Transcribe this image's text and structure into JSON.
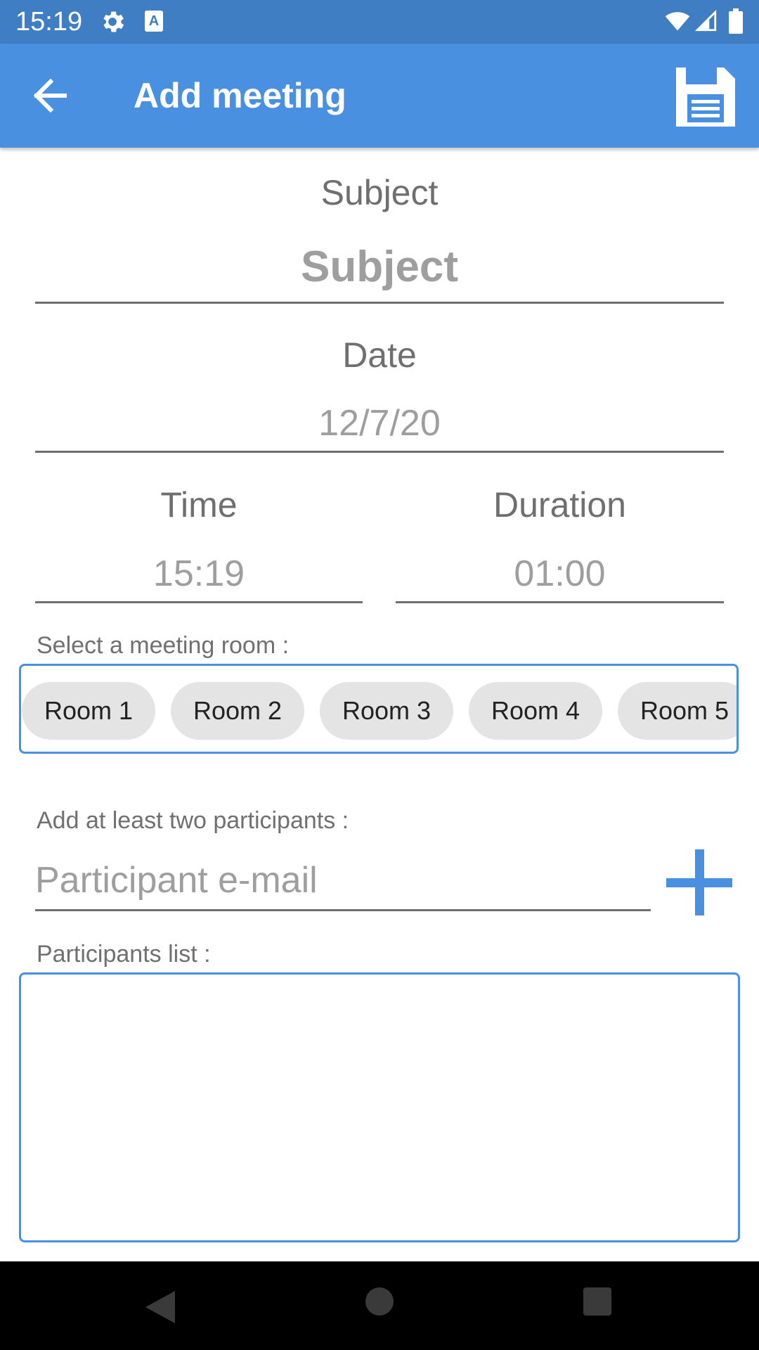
{
  "status_bar": {
    "time": "15:19",
    "icons": [
      "gear-icon",
      "a-keyboard-icon",
      "wifi-icon",
      "signal-icon",
      "battery-icon"
    ],
    "a_icon_text": "A"
  },
  "app_bar": {
    "title": "Add meeting",
    "back_icon": "arrow-left-icon",
    "save_icon": "floppy-disk-icon",
    "color": "#4a90e0"
  },
  "form": {
    "subject": {
      "label": "Subject",
      "placeholder": "Subject"
    },
    "date": {
      "label": "Date",
      "value": "12/7/20"
    },
    "time": {
      "label": "Time",
      "value": "15:19"
    },
    "duration": {
      "label": "Duration",
      "value": "01:00"
    },
    "room": {
      "label": "Select a meeting room :",
      "options": [
        "Room 1",
        "Room 2",
        "Room 3",
        "Room 4",
        "Room 5"
      ]
    },
    "participants": {
      "label": "Add at least two participants :",
      "email_placeholder": "Participant e-mail",
      "add_icon": "plus-icon",
      "list_label": "Participants list :"
    }
  },
  "nav_bar": {
    "icons": [
      "triangle-back-icon",
      "circle-home-icon",
      "square-recent-icon"
    ]
  }
}
